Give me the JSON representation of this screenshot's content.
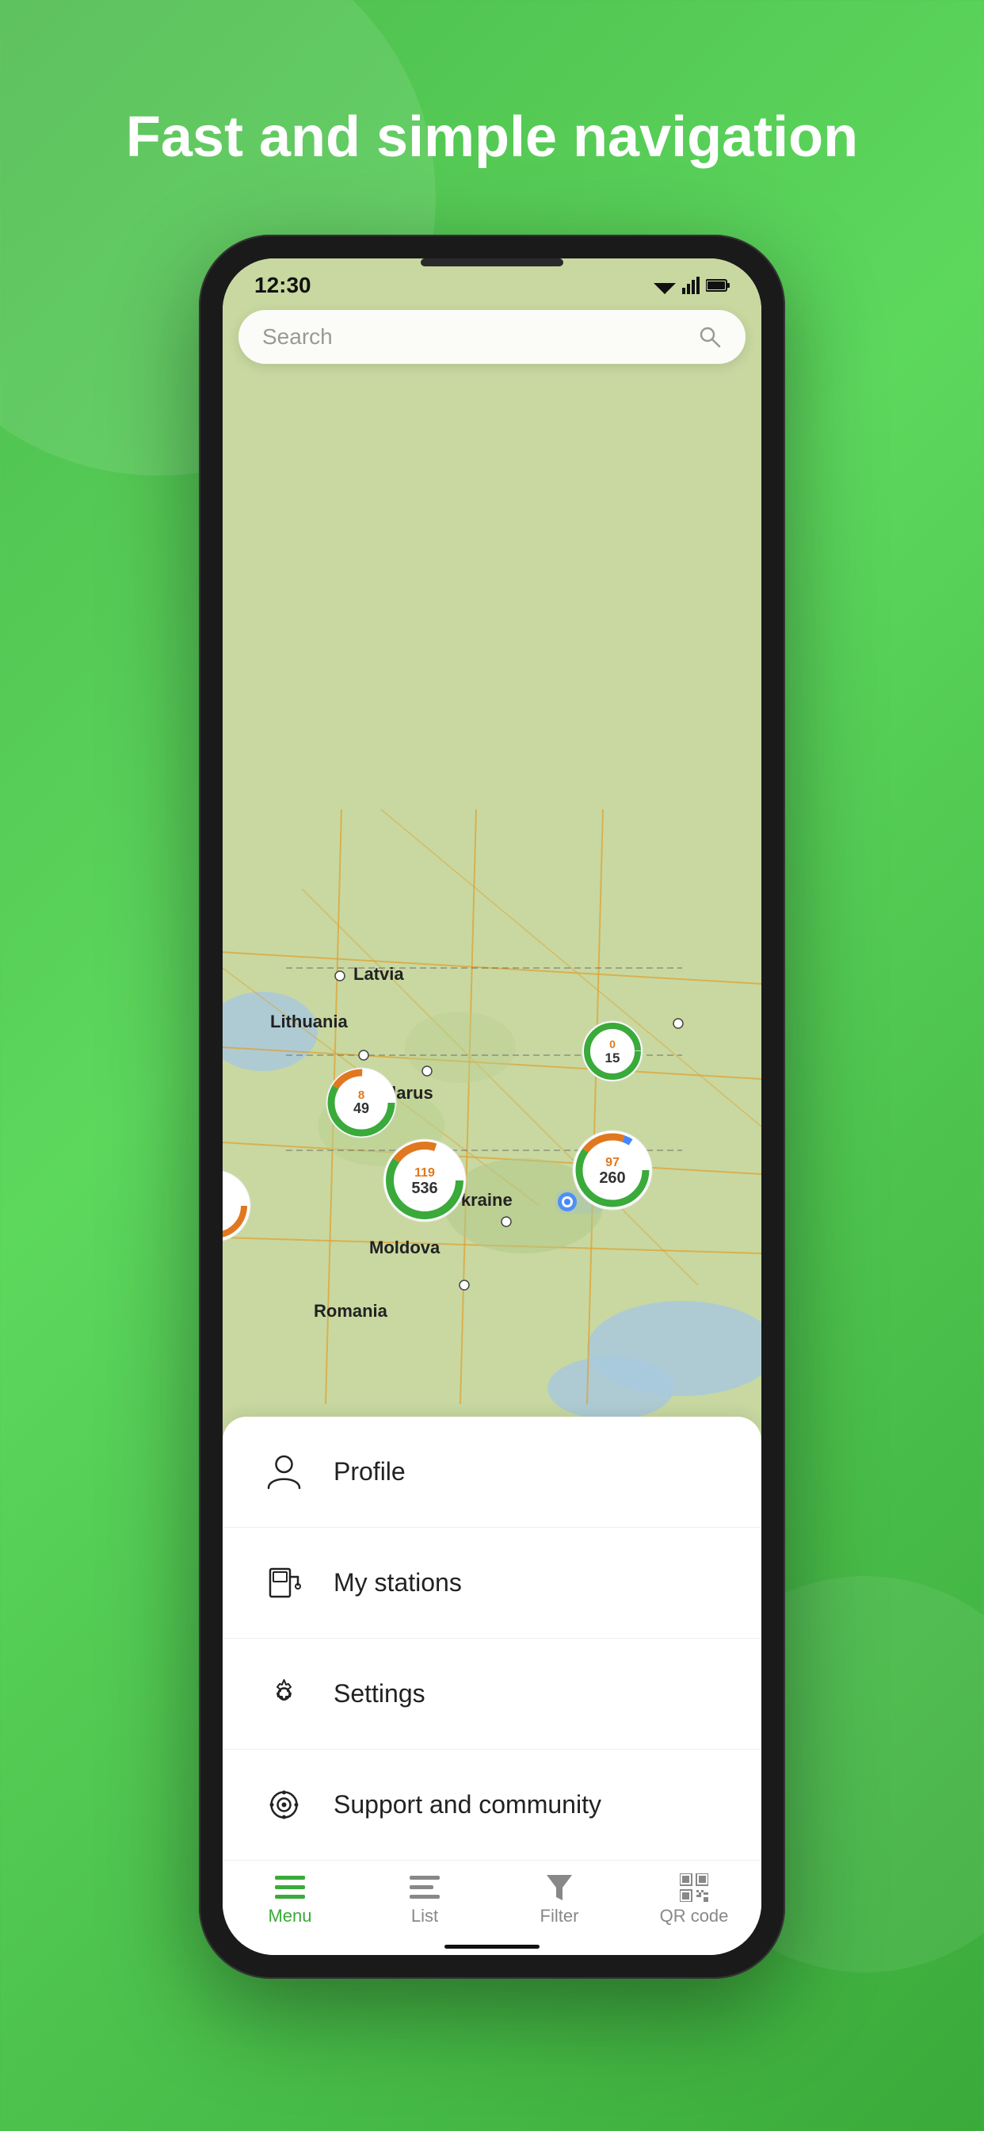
{
  "page": {
    "title": "Fast and simple navigation",
    "background_color": "#4cbb4c"
  },
  "status_bar": {
    "time": "12:30",
    "wifi": "▲",
    "signal": "▲",
    "battery": "🔋"
  },
  "search": {
    "placeholder": "Search"
  },
  "map": {
    "labels": [
      {
        "text": "Latvia",
        "top": "195",
        "left": "165"
      },
      {
        "text": "Lithuania",
        "top": "255",
        "left": "60"
      },
      {
        "text": "Belarus",
        "top": "345",
        "left": "185"
      },
      {
        "text": "Ukraine",
        "top": "500",
        "left": "285"
      },
      {
        "text": "Moldova",
        "top": "545",
        "left": "185"
      },
      {
        "text": "Romania",
        "top": "635",
        "left": "115"
      }
    ],
    "clusters": [
      {
        "id": "c1",
        "top": "360",
        "left": "175",
        "num1": "8",
        "num2": "49",
        "size": 85
      },
      {
        "id": "c2",
        "top": "275",
        "left": "445",
        "num1": "0",
        "num2": "15",
        "size": 75
      },
      {
        "id": "c3",
        "top": "440",
        "left": "220",
        "num1": "119",
        "num2": "536",
        "size": 100
      },
      {
        "id": "c4",
        "top": "430",
        "left": "425",
        "num1": "97",
        "num2": "260",
        "size": 95
      }
    ]
  },
  "menu": {
    "items": [
      {
        "id": "profile",
        "label": "Profile",
        "icon": "person"
      },
      {
        "id": "my-stations",
        "label": "My stations",
        "icon": "gas-station"
      },
      {
        "id": "settings",
        "label": "Settings",
        "icon": "gear"
      },
      {
        "id": "support",
        "label": "Support and community",
        "icon": "community"
      }
    ]
  },
  "bottom_nav": {
    "items": [
      {
        "id": "menu",
        "label": "Menu",
        "active": true
      },
      {
        "id": "list",
        "label": "List",
        "active": false
      },
      {
        "id": "filter",
        "label": "Filter",
        "active": false
      },
      {
        "id": "qrcode",
        "label": "QR code",
        "active": false
      }
    ]
  }
}
